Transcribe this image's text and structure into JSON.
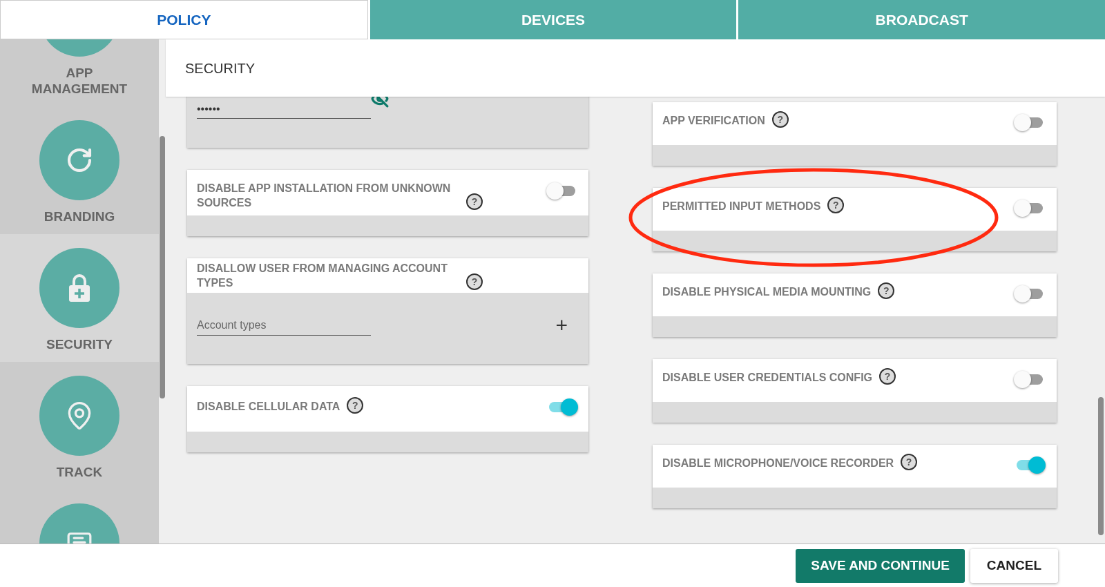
{
  "tabs": [
    {
      "label": "POLICY",
      "selected": true
    },
    {
      "label": "DEVICES",
      "selected": false
    },
    {
      "label": "BROADCAST",
      "selected": false
    }
  ],
  "sidebar": {
    "items": [
      {
        "label": "APP MANAGEMENT",
        "selected": false,
        "kind": "blank"
      },
      {
        "label": "BRANDING",
        "selected": false,
        "kind": "refresh"
      },
      {
        "label": "SECURITY",
        "selected": true,
        "kind": "lock"
      },
      {
        "label": "TRACK",
        "selected": false,
        "kind": "track"
      },
      {
        "selected": false,
        "kind": "message"
      }
    ]
  },
  "section": {
    "title": "SECURITY"
  },
  "left_cards": [
    {
      "kind": "password",
      "value": "••••••"
    },
    {
      "kind": "toggle",
      "label": "DISABLE APP INSTALLATION FROM UNKNOWN SOURCES",
      "help": "?",
      "on": false
    },
    {
      "kind": "list",
      "label": "DISALLOW USER FROM MANAGING ACCOUNT TYPES",
      "help": "?",
      "placeholder": "Account types",
      "add": "+"
    },
    {
      "kind": "toggle",
      "label": "DISABLE CELLULAR DATA",
      "help": "?",
      "on": true
    }
  ],
  "right_cards": [
    {
      "label": "APP VERIFICATION",
      "help": "?",
      "on": false,
      "highlighted": false
    },
    {
      "label": "PERMITTED INPUT METHODS",
      "help": "?",
      "on": false,
      "highlighted": true
    },
    {
      "label": "DISABLE PHYSICAL MEDIA MOUNTING",
      "help": "?",
      "on": false,
      "highlighted": false
    },
    {
      "label": "DISABLE USER CREDENTIALS CONFIG",
      "help": "?",
      "on": false,
      "highlighted": false
    },
    {
      "label": "DISABLE MICROPHONE/VOICE RECORDER",
      "help": "?",
      "on": true,
      "highlighted": false
    }
  ],
  "footer": {
    "buttons": [
      {
        "label": "SAVE AND CONTINUE",
        "kind": "primary"
      },
      {
        "label": "CANCEL",
        "kind": "secondary"
      }
    ]
  }
}
